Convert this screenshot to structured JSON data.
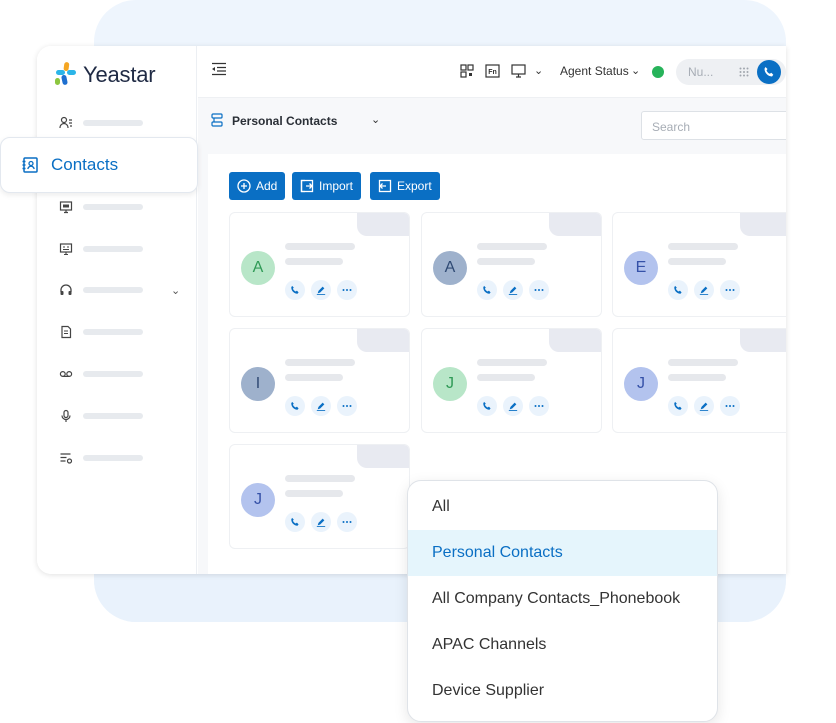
{
  "app": {
    "logo_text": "Yeastar"
  },
  "sidebar": {
    "active_label": "Contacts",
    "items": [
      {
        "icon": "user-list-icon"
      },
      {
        "icon": "contacts-icon",
        "label": "Contacts"
      },
      {
        "icon": "monitor-icon"
      },
      {
        "icon": "wallboard-icon"
      },
      {
        "icon": "headset-icon"
      },
      {
        "icon": "report-icon"
      },
      {
        "icon": "voicemail-icon"
      },
      {
        "icon": "microphone-icon"
      },
      {
        "icon": "settings-list-icon"
      }
    ]
  },
  "topbar": {
    "agent_status": "Agent Status",
    "number_placeholder": "Nu..."
  },
  "toolbar": {
    "phonebook_title": "Personal Contacts",
    "search_placeholder": "Search",
    "add_label": "Add",
    "import_label": "Import",
    "export_label": "Export"
  },
  "cards": [
    {
      "initial": "A",
      "color": "green"
    },
    {
      "initial": "A",
      "color": "slate"
    },
    {
      "initial": "E",
      "color": "blue"
    },
    {
      "initial": "I",
      "color": "slate"
    },
    {
      "initial": "J",
      "color": "green"
    },
    {
      "initial": "J",
      "color": "blue"
    },
    {
      "initial": "J",
      "color": "blue"
    }
  ],
  "dropdown": {
    "options": [
      "All",
      "Personal Contacts",
      "All Company Contacts_Phonebook",
      "APAC Channels",
      "Device Supplier"
    ],
    "selected": "Personal Contacts"
  },
  "colors": {
    "accent": "#0a6fc4",
    "status_online": "#27b35a"
  }
}
